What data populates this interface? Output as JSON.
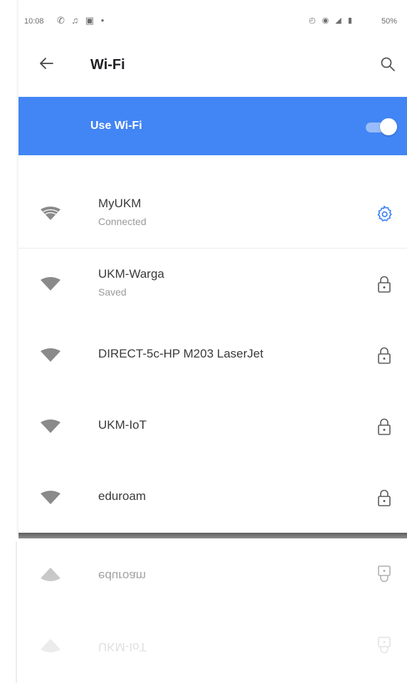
{
  "status_bar": {
    "time": "10:08",
    "left_icons": "✆ ♫ ▣ •",
    "right_icons": "◴ ◉ ◢ ▮",
    "battery": "50%"
  },
  "app_bar": {
    "title": "Wi-Fi",
    "back_icon": "arrow-left-icon",
    "search_icon": "search-icon"
  },
  "wifi_toggle": {
    "label": "Use Wi-Fi",
    "enabled": true,
    "accent_color": "#4285f4"
  },
  "networks": [
    {
      "name": "MyUKM",
      "status": "Connected",
      "action_icon": "gear-icon"
    },
    {
      "name": "UKM-Warga",
      "status": "Saved",
      "action_icon": "lock-icon"
    },
    {
      "name": "DIRECT-5c-HP M203 LaserJet",
      "action_icon": "lock-icon"
    },
    {
      "name": "UKM-IoT",
      "action_icon": "lock-icon"
    },
    {
      "name": "eduroam",
      "action_icon": "lock-icon"
    }
  ]
}
